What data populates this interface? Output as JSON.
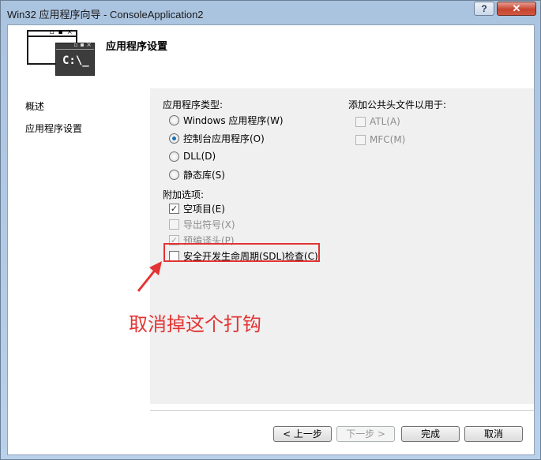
{
  "window": {
    "title": "Win32 应用程序向导 - ConsoleApplication2",
    "help_label": "?",
    "close_label": "✕"
  },
  "header": {
    "title": "应用程序设置",
    "icon_dots": "▫ ▪ ×",
    "icon_prompt": "C:\\_"
  },
  "sidebar": {
    "items": [
      {
        "label": "概述"
      },
      {
        "label": "应用程序设置"
      }
    ]
  },
  "app_type": {
    "heading": "应用程序类型:",
    "options": [
      {
        "label": "Windows 应用程序(W)",
        "selected": false
      },
      {
        "label": "控制台应用程序(O)",
        "selected": true
      },
      {
        "label": "DLL(D)",
        "selected": false
      },
      {
        "label": "静态库(S)",
        "selected": false
      }
    ]
  },
  "additional": {
    "heading": "附加选项:",
    "options": [
      {
        "label": "空项目(E)",
        "checked": true,
        "enabled": true
      },
      {
        "label": "导出符号(X)",
        "checked": false,
        "enabled": false
      },
      {
        "label": "预编译头(P)",
        "checked": true,
        "enabled": false
      },
      {
        "label": "安全开发生命周期(SDL)检查(C)",
        "checked": false,
        "enabled": true
      }
    ]
  },
  "common_headers": {
    "heading": "添加公共头文件以用于:",
    "options": [
      {
        "label": "ATL(A)",
        "checked": false,
        "enabled": false
      },
      {
        "label": "MFC(M)",
        "checked": false,
        "enabled": false
      }
    ]
  },
  "annotation": {
    "text": "取消掉这个打钩",
    "color": "#e33333"
  },
  "footer": {
    "prev_label": "< 上一步",
    "next_label": "下一步 >",
    "finish_label": "完成",
    "cancel_label": "取消"
  },
  "colors": {
    "title_bar": "#b9d1ea",
    "close_button": "#c7432e",
    "radio_dot": "#1c6fb5"
  }
}
